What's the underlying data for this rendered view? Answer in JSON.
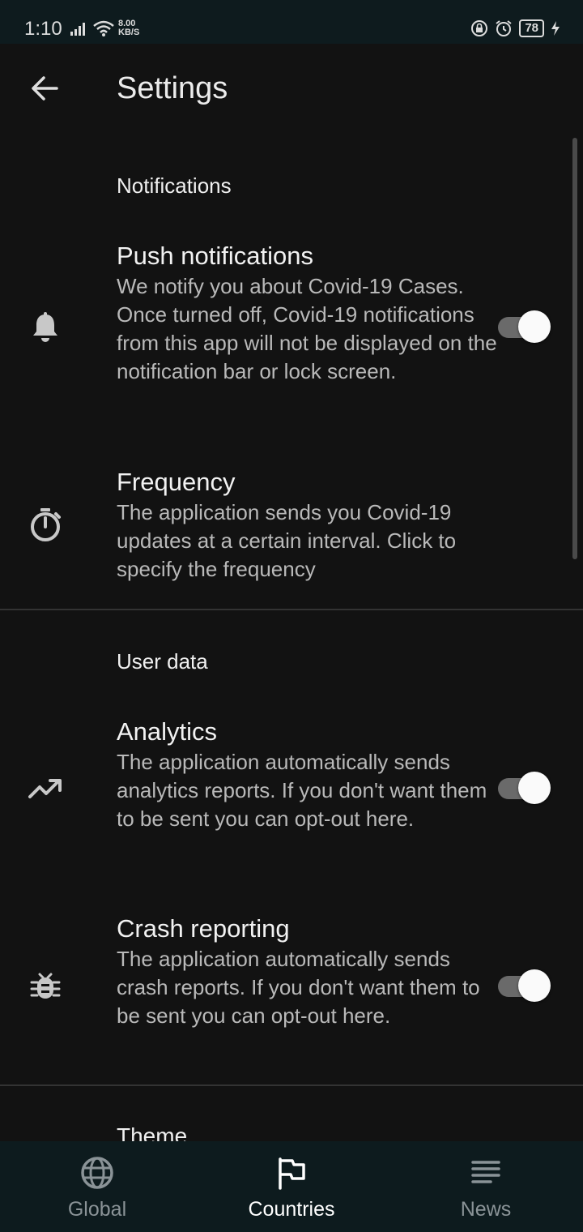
{
  "status_bar": {
    "time": "1:10",
    "net_speed": "8.00",
    "net_unit": "KB/S",
    "battery": "78"
  },
  "app_bar": {
    "title": "Settings",
    "back_icon": "arrow-left-icon"
  },
  "sections": {
    "notifications": {
      "title": "Notifications",
      "push": {
        "title": "Push notifications",
        "summary": "We notify you about Covid-19 Cases. Once turned off, Covid-19 notifications from this app will not be displayed on the notification bar or lock screen.",
        "icon": "bell-icon",
        "enabled": true
      },
      "frequency": {
        "title": "Frequency",
        "summary": "The application sends you Covid-19 updates at a certain interval. Click to specify the frequency",
        "icon": "timer-icon"
      }
    },
    "user_data": {
      "title": "User data",
      "analytics": {
        "title": "Analytics",
        "summary": "The application automatically sends analytics reports. If you don't want them to be sent you can opt-out here.",
        "icon": "trending-up-icon",
        "enabled": true
      },
      "crash": {
        "title": "Crash reporting",
        "summary": "The application automatically sends crash reports. If you don't want them to be sent you can opt-out here.",
        "icon": "bug-icon",
        "enabled": true
      }
    },
    "theme": {
      "title": "Theme"
    }
  },
  "bottom_nav": {
    "items": [
      {
        "label": "Global",
        "icon": "globe-icon",
        "active": false
      },
      {
        "label": "Countries",
        "icon": "flag-icon",
        "active": true
      },
      {
        "label": "News",
        "icon": "news-icon",
        "active": false
      }
    ]
  },
  "colors": {
    "background": "#121212",
    "status_bar": "#0e1b1e",
    "bottom_nav": "#0d1b1e",
    "switch_track": "#6a6a6a",
    "switch_thumb": "#fafafa"
  }
}
